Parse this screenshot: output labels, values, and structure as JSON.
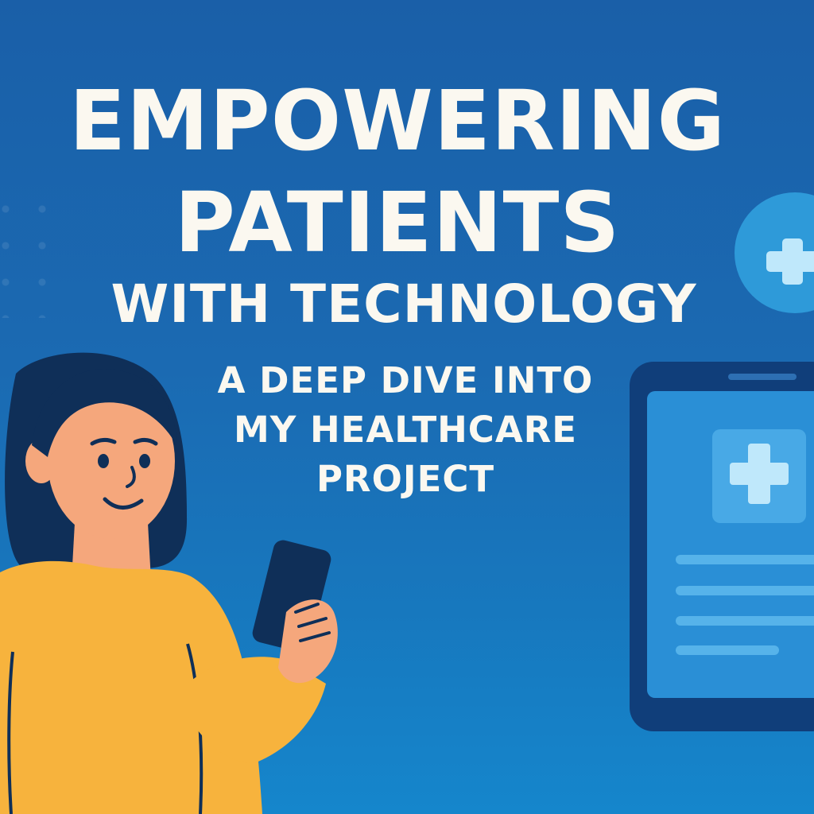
{
  "title": {
    "line1": "EMPOWERING",
    "line2": "PATIENTS",
    "line3": "WITH TECHNOLOGY"
  },
  "subtitle": {
    "line1": "A DEEP DIVE INTO",
    "line2": "MY HEALTHCARE",
    "line3": "PROJECT"
  },
  "colors": {
    "background_top": "#1a5fa8",
    "background_bottom": "#1586cc",
    "text": "#fbf8f0",
    "sweater": "#f7b33d",
    "skin": "#f5a77c",
    "hair": "#0f2f58",
    "tablet_frame": "#103e7a",
    "tablet_screen": "#2a8fd6",
    "accent_cross": "#bfe8fb"
  },
  "icons": {
    "badge": "medical-cross-icon",
    "tablet_badge": "medical-cross-icon",
    "illustration": "woman-with-phone-illustration"
  }
}
